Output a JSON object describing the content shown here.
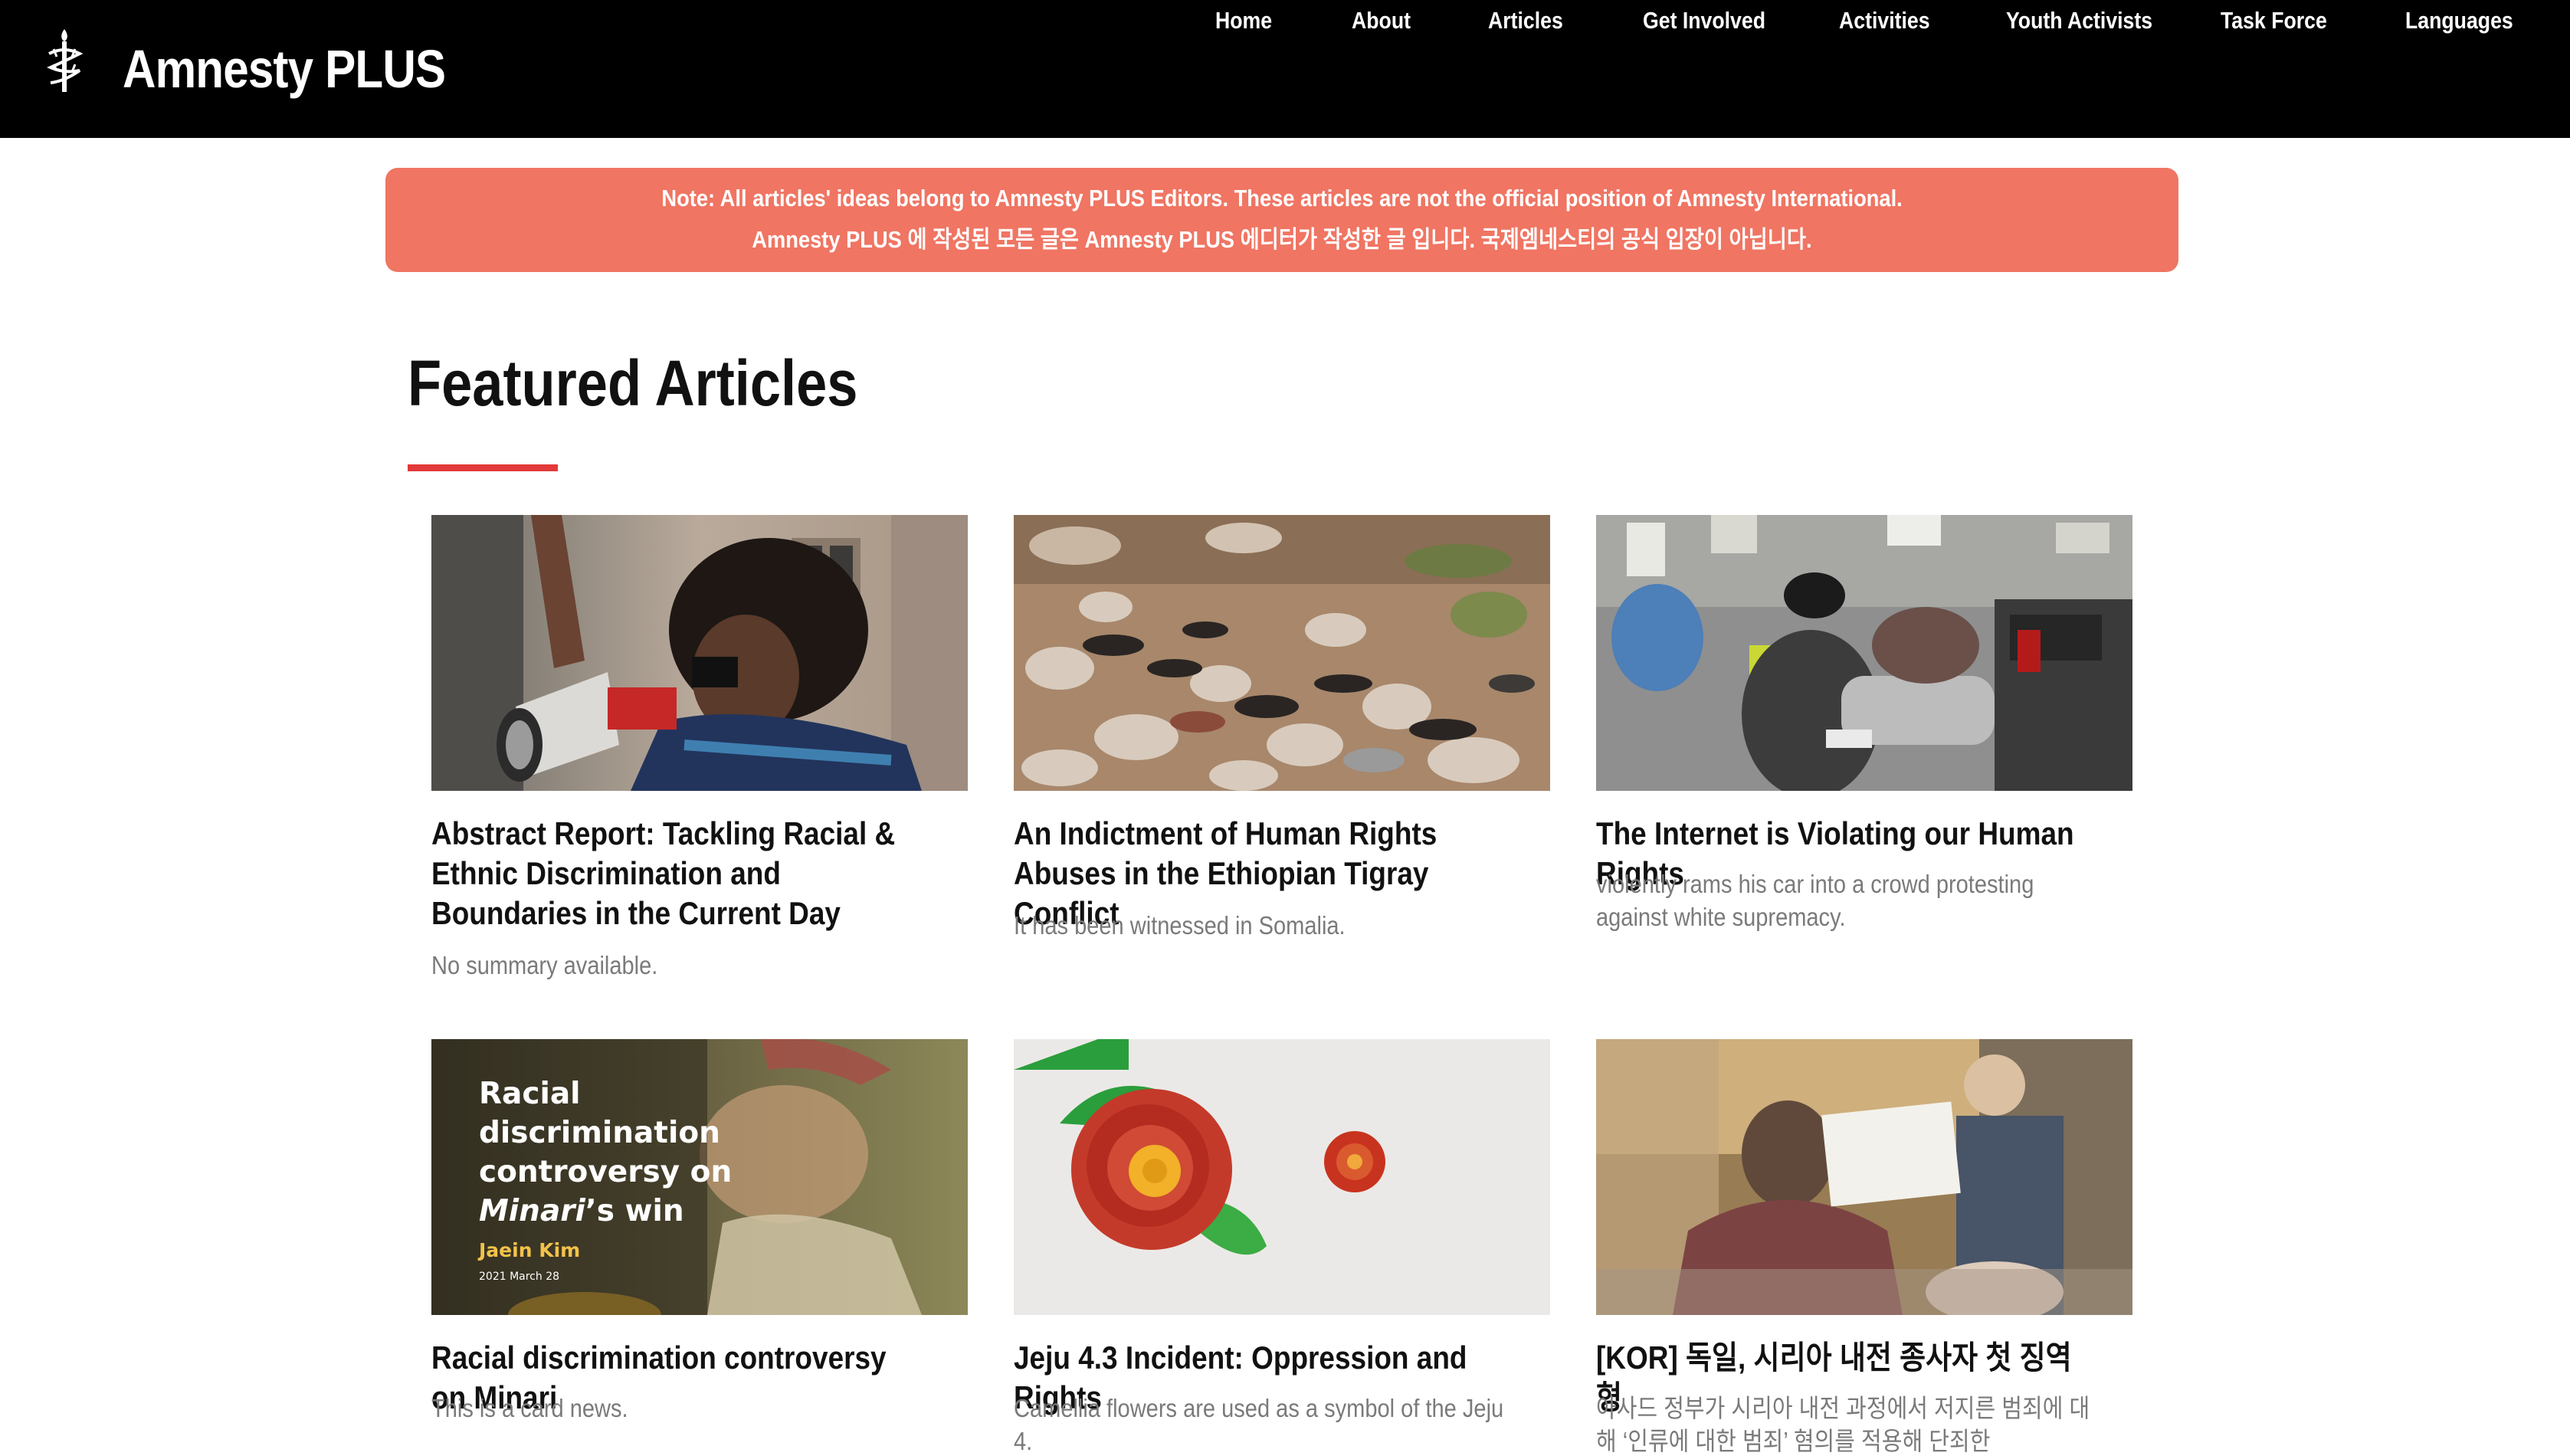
{
  "header": {
    "brand": "Amnesty PLUS",
    "logo_icon": "candle-in-barbed-wire-icon",
    "nav": [
      "Home",
      "About",
      "Articles",
      "Get Involved",
      "Activities",
      "Youth Activists",
      "Task Force",
      "Languages"
    ]
  },
  "notice": {
    "line_en": "Note: All articles' ideas belong to Amnesty PLUS Editors. These articles are not the official position of Amnesty International.",
    "line_ko": "Amnesty PLUS 에 작성된 모든 글은 Amnesty PLUS 에디터가 작성한 글 입니다. 국제엠네스티의 공식 입장이 아닙니다.",
    "color": "#f07563"
  },
  "section": {
    "title": "Featured Articles",
    "accent_color": "#e23a3a"
  },
  "articles": [
    {
      "title": "Abstract Report: Tackling Racial & Ethnic Discrimination and Boundaries in the Current Day",
      "summary": "No summary available.",
      "image": "protester-with-megaphone-photo"
    },
    {
      "title": "An Indictment of Human Rights Abuses in the Ethiopian Tigray Conflict",
      "summary": "It has been witnessed in Somalia.",
      "image": "abandoned-shoes-on-rocks-photo"
    },
    {
      "title": "The Internet is Violating our Human Rights",
      "summary": "violently rams his car into a crowd protesting against white supremacy.",
      "image": "car-ramming-crowd-photo"
    },
    {
      "title": "Racial discrimination controversy on Minari",
      "summary": "This is a card news.",
      "image": "minari-card-news-poster",
      "poster": {
        "line1": "Racial",
        "line2": "discrimination",
        "line3": "controversy on",
        "line4_italic": "Minari",
        "line4_rest": "’s win",
        "author": "Jaein Kim",
        "date": "2021 March 28"
      }
    },
    {
      "title": "Jeju 4.3 Incident: Oppression and Rights",
      "summary": "Camellia flowers are used as a symbol of the Jeju 4.",
      "image": "paper-camellia-flowers-photo"
    },
    {
      "title": "[KOR] 독일, 시리아 내전 종사자 첫 징역형",
      "summary": "아사드 정부가 시리아 내전 과정에서 저지른 범죄에 대해 ‘인류에 대한 범죄’ 혐의를 적용해 단죄한",
      "image": "courtroom-defendant-photo"
    }
  ]
}
